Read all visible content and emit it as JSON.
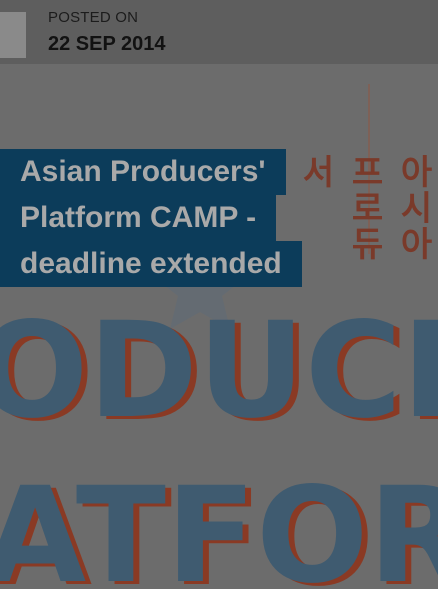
{
  "meta": {
    "posted_label": "POSTED ON",
    "date": "22 SEP 2014"
  },
  "headline": {
    "lines": [
      "Asian Producers'",
      "Platform CAMP -",
      "deadline extended"
    ]
  },
  "poster": {
    "row1": "ODUCE",
    "row2": "ATFOR",
    "side_text": "아시아 프로듀서"
  },
  "colors": {
    "headline_bg": "#0c3c5a",
    "headline_text": "#a9a9a9",
    "poster_blue": "#3f5b70",
    "poster_red": "#8a3a24"
  }
}
